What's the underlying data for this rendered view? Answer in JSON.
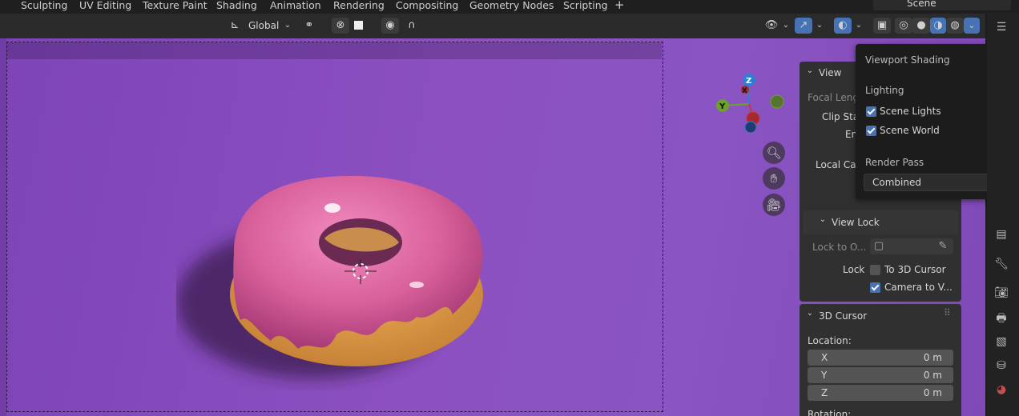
{
  "workspace_tabs": [
    "Sculpting",
    "UV Editing",
    "Texture Paint",
    "Shading",
    "Animation",
    "Rendering",
    "Compositing",
    "Geometry Nodes",
    "Scripting",
    "+"
  ],
  "scene": {
    "name": "Scene"
  },
  "header": {
    "transform_orientation": "Global",
    "icons": [
      "transform-orientation-icon",
      "pivot-icon",
      "snap-icon",
      "proportional-edit-icon",
      "falloff-icon",
      "visibility-icon",
      "gizmo-icon",
      "overlay-icon",
      "xray-icon",
      "wireframe-shading-icon",
      "solid-shading-icon",
      "material-preview-icon",
      "rendered-shading-icon",
      "shading-dropdown-icon"
    ]
  },
  "navigation_gizmo": {
    "z": "Z",
    "y": "Y",
    "x": "X"
  },
  "view_panel": {
    "title": "View",
    "focal_length": "Focal Lengt",
    "clip_start": "Clip Sta",
    "end": "En",
    "local_camera": "Local Ca",
    "view_lock_title": "View Lock",
    "lock_to_object": "Lock to O...",
    "lock": "Lock",
    "to_3d_cursor": "To 3D Cursor",
    "to_3d_cursor_checked": false,
    "camera_to_view": "Camera to V...",
    "camera_to_view_checked": true
  },
  "cursor_panel": {
    "title": "3D Cursor",
    "location_label": "Location:",
    "x_label": "X",
    "x_value": "0 m",
    "y_label": "Y",
    "y_value": "0 m",
    "z_label": "Z",
    "z_value": "0 m",
    "rotation_label": "Rotation:"
  },
  "shading_popover": {
    "title": "Viewport Shading",
    "lighting_label": "Lighting",
    "scene_lights": "Scene Lights",
    "scene_lights_checked": true,
    "scene_world": "Scene World",
    "scene_world_checked": true,
    "render_pass_label": "Render Pass",
    "render_pass_value": "Combined"
  },
  "colors": {
    "accent": "#4772b3",
    "viewport_bg": "#8a50c0",
    "icing": "#d9609a",
    "dough": "#d9a04a"
  }
}
